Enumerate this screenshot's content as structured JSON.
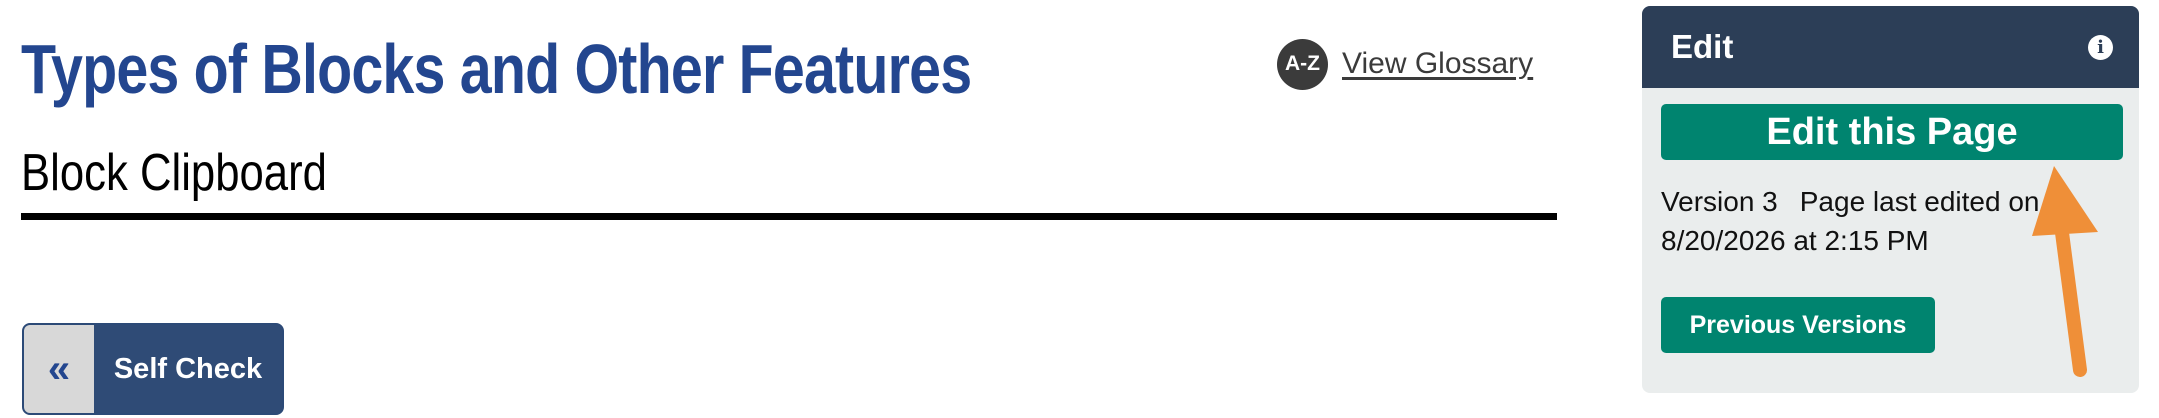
{
  "header": {
    "title": "Types of Blocks and Other Features",
    "subtitle": "Block Clipboard"
  },
  "glossary": {
    "icon_text": "A-Z",
    "link_text": "View Glossary"
  },
  "self_check": {
    "icon": "«",
    "label": "Self Check"
  },
  "edit_panel": {
    "title": "Edit",
    "info_icon": "i",
    "edit_button_label": "Edit this Page",
    "version": "Version 3",
    "last_edited": "Page last edited on 8/20/2026 at 2:15 PM",
    "previous_versions_label": "Previous Versions"
  },
  "colors": {
    "title_blue": "#23468f",
    "panel_header": "#2c3e57",
    "button_green": "#00846f",
    "annotation_arrow": "#ef8f38"
  }
}
